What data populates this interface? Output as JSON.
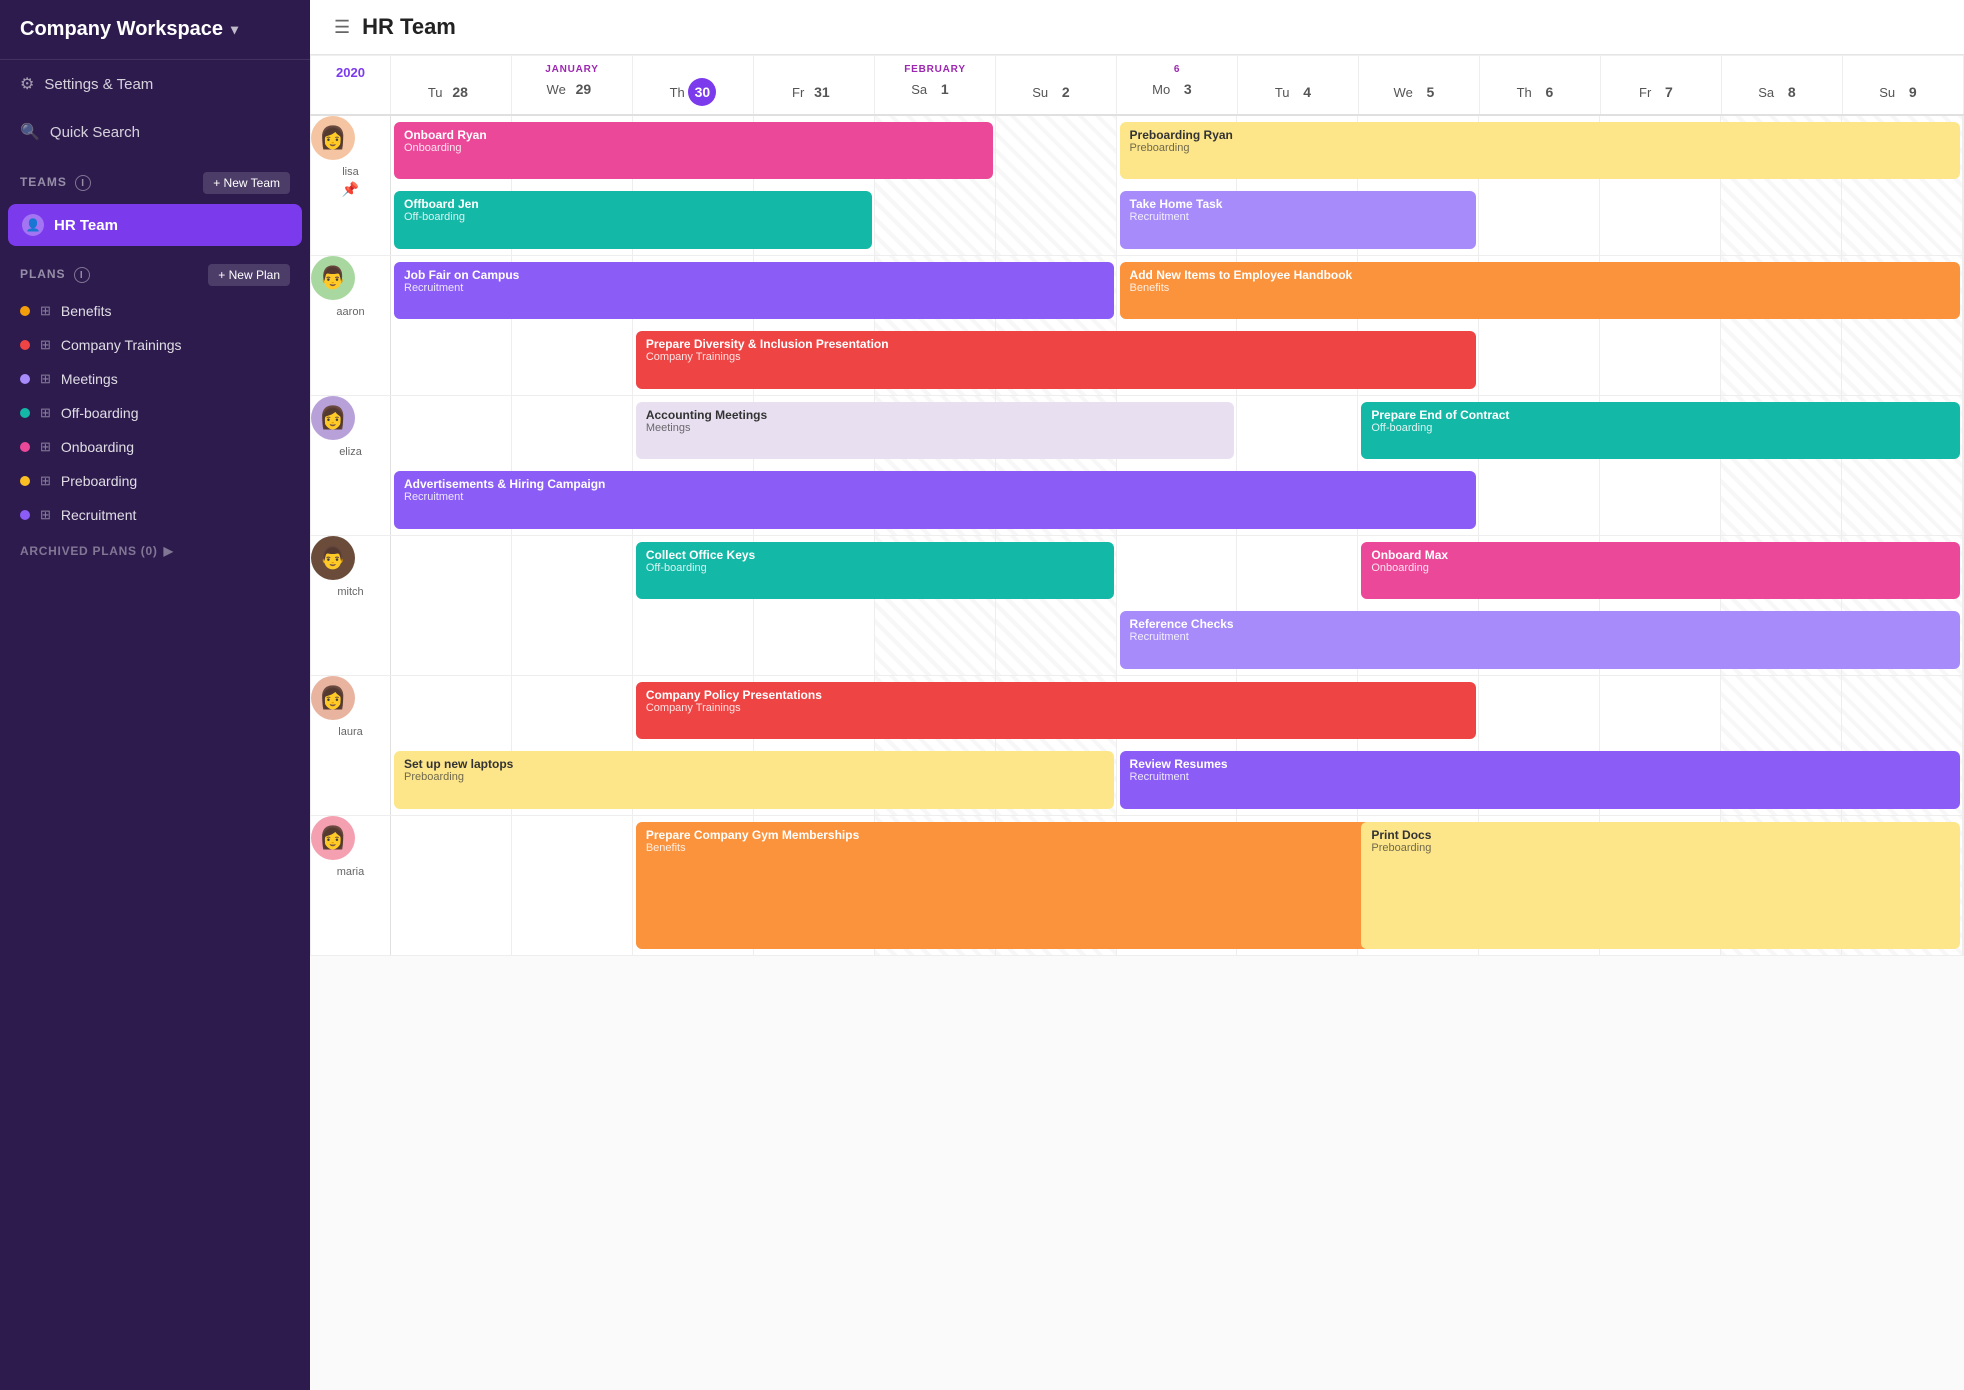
{
  "sidebar": {
    "workspace": "Company Workspace",
    "nav": [
      {
        "label": "Settings & Team",
        "icon": "⚙"
      },
      {
        "label": "Quick Search",
        "icon": "🔍"
      }
    ],
    "teams_section": "TEAMS",
    "new_team_btn": "+ New Team",
    "active_team": "HR Team",
    "plans_section": "PLANS",
    "new_plan_btn": "+ New Plan",
    "plans": [
      {
        "label": "Benefits",
        "color": "#f59e0b"
      },
      {
        "label": "Company Trainings",
        "color": "#ef4444"
      },
      {
        "label": "Meetings",
        "color": "#a78bfa"
      },
      {
        "label": "Off-boarding",
        "color": "#14b8a6"
      },
      {
        "label": "Onboarding",
        "color": "#ec4899"
      },
      {
        "label": "Preboarding",
        "color": "#fbbf24"
      },
      {
        "label": "Recruitment",
        "color": "#8b5cf6"
      }
    ],
    "archived": "ARCHIVED PLANS (0)"
  },
  "header": {
    "title": "HR Team"
  },
  "timeline": {
    "year": "2020",
    "columns": [
      {
        "month": "",
        "day": "Tu",
        "num": "28",
        "today": false
      },
      {
        "month": "JANUARY",
        "day": "We",
        "num": "29",
        "today": false
      },
      {
        "month": "",
        "day": "Th",
        "num": "30",
        "today": true
      },
      {
        "month": "",
        "day": "Fr",
        "num": "31",
        "today": false
      },
      {
        "month": "FEBRUARY",
        "day": "Sa",
        "num": "1",
        "today": false
      },
      {
        "month": "",
        "day": "Su",
        "num": "2",
        "today": false
      },
      {
        "month": "6",
        "day": "Mo",
        "num": "3",
        "today": false
      },
      {
        "month": "",
        "day": "Tu",
        "num": "4",
        "today": false
      },
      {
        "month": "",
        "day": "We",
        "num": "5",
        "today": false
      },
      {
        "month": "",
        "day": "Th",
        "num": "6",
        "today": false
      },
      {
        "month": "",
        "day": "Fr",
        "num": "7",
        "today": false
      },
      {
        "month": "",
        "day": "Sa",
        "num": "8",
        "today": false
      },
      {
        "month": "",
        "day": "Su",
        "num": "9",
        "today": false
      }
    ],
    "people": [
      {
        "name": "lisa",
        "face_color": "#f5c5a3",
        "pinned": true,
        "tasks": [
          {
            "label": "Onboard Ryan",
            "sub": "Onboarding",
            "color": "#ec4899",
            "col_start": 1,
            "col_end": 5,
            "row": 0
          },
          {
            "label": "Preboarding Ryan",
            "sub": "Preboarding",
            "color": "#fde68a",
            "dark": true,
            "col_start": 7,
            "col_end": 13,
            "row": 0
          },
          {
            "label": "Offboard Jen",
            "sub": "Off-boarding",
            "color": "#14b8a6",
            "col_start": 1,
            "col_end": 4,
            "row": 1
          },
          {
            "label": "Take Home Task",
            "sub": "Recruitment",
            "color": "#a78bfa",
            "col_start": 7,
            "col_end": 9,
            "row": 1
          }
        ]
      },
      {
        "name": "aaron",
        "face_color": "#a8d8a0",
        "tasks": [
          {
            "label": "Job Fair on Campus",
            "sub": "Recruitment",
            "color": "#8b5cf6",
            "col_start": 1,
            "col_end": 6,
            "row": 0
          },
          {
            "label": "Add New Items to Employee Handbook",
            "sub": "Benefits",
            "color": "#fb923c",
            "col_start": 7,
            "col_end": 13,
            "row": 0
          },
          {
            "label": "Prepare Diversity & Inclusion Presentation",
            "sub": "Company Trainings",
            "color": "#ef4444",
            "col_start": 3,
            "col_end": 9,
            "row": 1
          }
        ]
      },
      {
        "name": "eliza",
        "face_color": "#b8a0d8",
        "tasks": [
          {
            "label": "Accounting Meetings",
            "sub": "Meetings",
            "color": "#e8e0f0",
            "dark": true,
            "col_start": 3,
            "col_end": 7,
            "row": 0
          },
          {
            "label": "Prepare End of Contract",
            "sub": "Off-boarding",
            "color": "#14b8a6",
            "col_start": 9,
            "col_end": 13,
            "row": 0
          },
          {
            "label": "Advertisements & Hiring Campaign",
            "sub": "Recruitment",
            "color": "#8b5cf6",
            "col_start": 1,
            "col_end": 9,
            "row": 1
          }
        ]
      },
      {
        "name": "mitch",
        "face_color": "#6b4c3b",
        "tasks": [
          {
            "label": "Collect Office Keys",
            "sub": "Off-boarding",
            "color": "#14b8a6",
            "col_start": 3,
            "col_end": 6,
            "row": 0
          },
          {
            "label": "Onboard Max",
            "sub": "Onboarding",
            "color": "#ec4899",
            "col_start": 9,
            "col_end": 13,
            "row": 0
          },
          {
            "label": "Reference Checks",
            "sub": "Recruitment",
            "color": "#a78bfa",
            "col_start": 7,
            "col_end": 13,
            "row": 1
          }
        ]
      },
      {
        "name": "laura",
        "face_color": "#e8b4a0",
        "tasks": [
          {
            "label": "Company Policy Presentations",
            "sub": "Company Trainings",
            "color": "#ef4444",
            "col_start": 3,
            "col_end": 9,
            "row": 0
          },
          {
            "label": "Set up new laptops",
            "sub": "Preboarding",
            "color": "#fde68a",
            "dark": true,
            "col_start": 1,
            "col_end": 6,
            "row": 1
          },
          {
            "label": "Review Resumes",
            "sub": "Recruitment",
            "color": "#8b5cf6",
            "col_start": 7,
            "col_end": 13,
            "row": 1
          }
        ]
      },
      {
        "name": "maria",
        "face_color": "#f4a0b0",
        "tasks": [
          {
            "label": "Prepare Company Gym Memberships",
            "sub": "Benefits",
            "color": "#fb923c",
            "col_start": 3,
            "col_end": 9,
            "row": 0
          },
          {
            "label": "Print Docs",
            "sub": "Preboarding",
            "color": "#fde68a",
            "dark": true,
            "col_start": 9,
            "col_end": 13,
            "row": 0
          }
        ]
      }
    ]
  }
}
